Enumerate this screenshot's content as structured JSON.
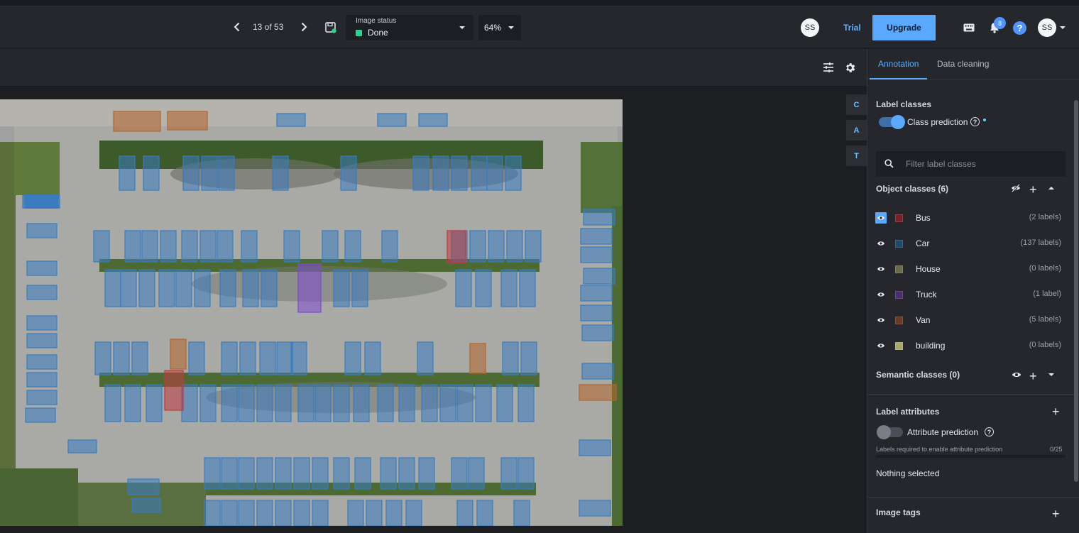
{
  "header": {
    "counter": "13 of 53",
    "image_status_label": "Image status",
    "image_status_value": "Done",
    "status_color": "#2fcf8e",
    "zoom": "64%",
    "collaborator_initials": "SS",
    "trial_label": "Trial",
    "upgrade_label": "Upgrade",
    "notification_count": "8",
    "help_label": "?",
    "user_initials": "SS",
    "icons": [
      "chevron-left-icon",
      "chevron-right-icon",
      "save-icon",
      "keyboard-icon",
      "bell-icon",
      "help-icon",
      "chevron-down-icon"
    ]
  },
  "toolbar": {
    "icons": [
      "sliders-icon",
      "gear-icon"
    ]
  },
  "tools": [
    {
      "label": "C"
    },
    {
      "label": "A"
    },
    {
      "label": "T"
    }
  ],
  "sidebar": {
    "tabs": [
      {
        "label": "Annotation",
        "active": true
      },
      {
        "label": "Data cleaning",
        "active": false
      }
    ],
    "label_classes_title": "Label classes",
    "class_prediction_label": "Class prediction",
    "class_prediction_on": true,
    "filter_placeholder": "Filter label classes",
    "object_classes_title": "Object classes (6)",
    "object_classes": [
      {
        "name": "Bus",
        "count": "(2 labels)",
        "color": "#7a1f27",
        "selected": true
      },
      {
        "name": "Car",
        "count": "(137 labels)",
        "color": "#1f4a6b",
        "selected": false
      },
      {
        "name": "House",
        "count": "(0 labels)",
        "color": "#6b6b4a",
        "selected": false
      },
      {
        "name": "Truck",
        "count": "(1 label)",
        "color": "#4d2e6a",
        "selected": false
      },
      {
        "name": "Van",
        "count": "(5 labels)",
        "color": "#6b3a24",
        "selected": false
      },
      {
        "name": "building",
        "count": "(0 labels)",
        "color": "#a9a66a",
        "selected": false
      }
    ],
    "semantic_classes_title": "Semantic classes (0)",
    "label_attributes_title": "Label attributes",
    "attribute_prediction_label": "Attribute prediction",
    "attribute_prediction_on": false,
    "attribute_note": "Labels required to enable attribute prediction",
    "attribute_progress": "0/25",
    "nothing_selected": "Nothing selected",
    "image_tags_title": "Image tags"
  },
  "colors": {
    "accent": "#5ba8ff",
    "car_box": "#3a7bbf",
    "bus_box": "#c0393f",
    "van_box": "#b5652b",
    "truck_box": "#7f4ad1"
  }
}
